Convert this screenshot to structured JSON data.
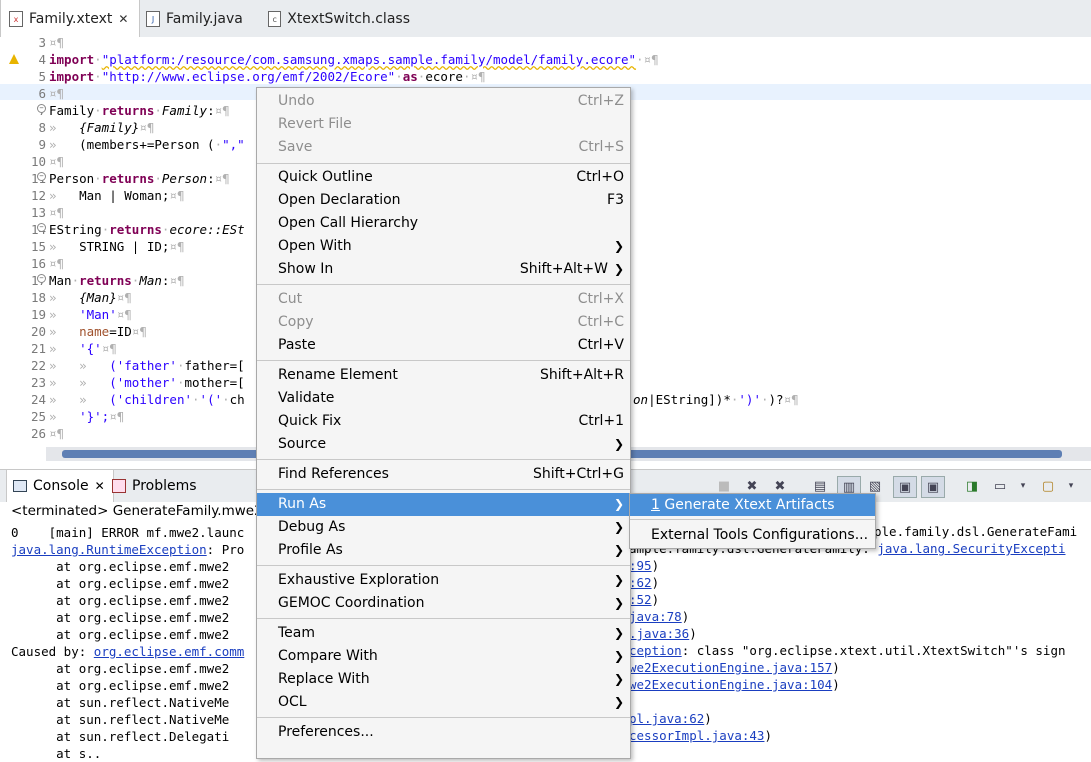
{
  "editor_tabs": [
    {
      "label": "Family.xtext",
      "icon": "xtext-file-icon",
      "active": true
    },
    {
      "label": "Family.java",
      "icon": "java-file-icon"
    },
    {
      "label": "XtextSwitch.class",
      "icon": "class-file-icon"
    }
  ],
  "code": {
    "line_numbers": [
      "3",
      "4",
      "5",
      "6",
      "7",
      "8",
      "9",
      "10",
      "11",
      "12",
      "13",
      "14",
      "15",
      "16",
      "17",
      "18",
      "19",
      "20",
      "21",
      "22",
      "23",
      "24",
      "25",
      "26"
    ],
    "l4_kw": "import",
    "l4_str": "\"platform:/resource/com.samsung.xmaps.sample.family/model/family.ecore\"",
    "l5_kw": "import",
    "l5_str": "\"http://www.eclipse.org/emf/2002/Ecore\"",
    "l5_as": "as",
    "l5_alias": "ecore",
    "l7_name": "Family",
    "returns": "returns",
    "l7_type": "Family",
    "l8": "{Family}",
    "l9_a": "(members+=Person (",
    "l9_b": "\",\"",
    "l11_name": "Person",
    "l11_type": "Person",
    "l12": "Man | Woman;",
    "l14_name": "EString",
    "l14_type": "ecore::ESt",
    "l15": "STRING | ID;",
    "l17_name": "Man",
    "l17_type": "Man",
    "l18": "{Man}",
    "l19": "'Man'",
    "l20_a": "name",
    "l20_b": "=ID",
    "l21": "'{'",
    "l22_a": "('father'",
    "l22_b": "father=[",
    "l23_a": "('mother'",
    "l23_b": "mother=[",
    "l24_a": "('children'",
    "l24_b": "'('",
    "l24_c": "ch",
    "l24_tail_it": "on",
    "l24_tail": "|EString])*",
    "l24_tail2": "')'",
    "l24_tail3": ")?",
    "l25": "'}';"
  },
  "console": {
    "tab_label": "Console",
    "problems_label": "Problems",
    "terminated": "<terminated> GenerateFamily.mwe2",
    "lines": [
      {
        "text": "0    [main] ERROR mf.mwe2.launc"
      },
      {
        "link": "java.lang.RuntimeException",
        "text": ": Pro"
      },
      {
        "text": "      at org.eclipse.emf.mwe2"
      },
      {
        "text": "      at org.eclipse.emf.mwe2"
      },
      {
        "text": "      at org.eclipse.emf.mwe2"
      },
      {
        "text": "      at org.eclipse.emf.mwe2"
      },
      {
        "text": "      at org.eclipse.emf.mwe2"
      },
      {
        "text": "Caused by: ",
        "link": "org.eclipse.emf.comm"
      },
      {
        "text": "      at org.eclipse.emf.mwe2"
      },
      {
        "text": "      at org.eclipse.emf.mwe2"
      },
      {
        "text": "      at sun.reflect.NativeMe"
      },
      {
        "text": "      at sun.reflect.NativeMe"
      },
      {
        "text": "      at sun.reflect.Delegati"
      },
      {
        "text": "      at s.."
      }
    ],
    "right": {
      "r1": "ple.family.dsl.GenerateFami",
      "r2_a": "ample.family.dsl.GenerateFamily: ",
      "r2_link": "java.lang.SecurityExcepti",
      "r3": ":95",
      "r4": ":62",
      "r5": ":52",
      "r6": "java:78",
      "r7": ".java:36",
      "r8_link": "ception",
      "r8": ": class \"org.eclipse.xtext.util.XtextSwitch\"'s sign",
      "r9": "we2ExecutionEngine.java:157",
      "r10": "we2ExecutionEngine.java:104",
      "r11": "pl.java:62",
      "r12": "cessorImpl.java:43"
    }
  },
  "context_menu": [
    {
      "label": "Undo",
      "shortcut": "Ctrl+Z",
      "disabled": true
    },
    {
      "label": "Revert File",
      "disabled": true
    },
    {
      "label": "Save",
      "shortcut": "Ctrl+S",
      "disabled": true
    },
    {
      "label": "Quick Outline",
      "shortcut": "Ctrl+O"
    },
    {
      "label": "Open Declaration",
      "shortcut": "F3"
    },
    {
      "label": "Open Call Hierarchy"
    },
    {
      "label": "Open With",
      "submenu": true
    },
    {
      "label": "Show In",
      "shortcut": "Shift+Alt+W",
      "submenu": true
    },
    {
      "label": "Cut",
      "shortcut": "Ctrl+X",
      "disabled": true
    },
    {
      "label": "Copy",
      "shortcut": "Ctrl+C",
      "disabled": true
    },
    {
      "label": "Paste",
      "shortcut": "Ctrl+V"
    },
    {
      "label": "Rename Element",
      "shortcut": "Shift+Alt+R"
    },
    {
      "label": "Validate"
    },
    {
      "label": "Quick Fix",
      "shortcut": "Ctrl+1"
    },
    {
      "label": "Source",
      "submenu": true
    },
    {
      "label": "Find References",
      "shortcut": "Shift+Ctrl+G"
    },
    {
      "label": "Run As",
      "submenu": true,
      "highlighted": true
    },
    {
      "label": "Debug As",
      "submenu": true
    },
    {
      "label": "Profile As",
      "submenu": true
    },
    {
      "label": "Exhaustive Exploration",
      "submenu": true
    },
    {
      "label": "GEMOC Coordination",
      "submenu": true
    },
    {
      "label": "Team",
      "submenu": true
    },
    {
      "label": "Compare With",
      "submenu": true
    },
    {
      "label": "Replace With",
      "submenu": true
    },
    {
      "label": "OCL",
      "submenu": true
    },
    {
      "label": "Preferences..."
    }
  ],
  "submenu": {
    "item1_num": "1",
    "item1": "Generate Xtext Artifacts",
    "item2": "External Tools Configurations..."
  },
  "colors": {
    "menu_highlight": "#4a90d9",
    "keyword": "#7f0055",
    "string": "#2a00ff",
    "link": "#1a3ec0"
  }
}
